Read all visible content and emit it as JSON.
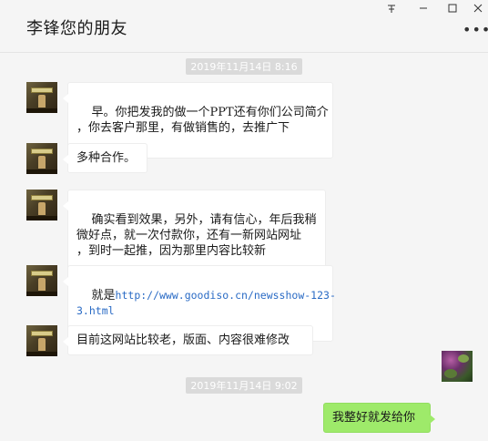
{
  "window": {
    "title": "李锋您的朋友",
    "pin_icon": "pin-icon",
    "minimize_icon": "minimize-icon",
    "maximize_icon": "maximize-icon",
    "close_icon": "close-icon",
    "more_icon": "more-icon"
  },
  "timestamps": [
    "2019年11月14日 8:16",
    "2019年11月14日 9:02"
  ],
  "messages": [
    {
      "side": "left",
      "text": "早。你把发我的做一个PPT还有你们公司简介\n，你去客户那里，有做销售的，去推广下"
    },
    {
      "side": "left",
      "text": "多种合作。"
    },
    {
      "side": "left",
      "text": "确实看到效果，另外，请有信心，年后我稍\n微好点，就一次付款你，还有一新网站网址\n，到时一起推，因为那里内容比较新"
    },
    {
      "side": "left",
      "prefix": "就是",
      "link": "http://www.goodiso.cn/newsshow-123-\n3.html"
    },
    {
      "side": "left",
      "text": "目前这网站比较老，版面、内容很难修改"
    },
    {
      "side": "right",
      "text": "我整好就发给你"
    }
  ],
  "colors": {
    "self_bubble": "#9eea6a",
    "other_bubble": "#ffffff",
    "background": "#f5f5f5",
    "link": "#2a6bc5",
    "timestamp_bg": "#dadada"
  }
}
